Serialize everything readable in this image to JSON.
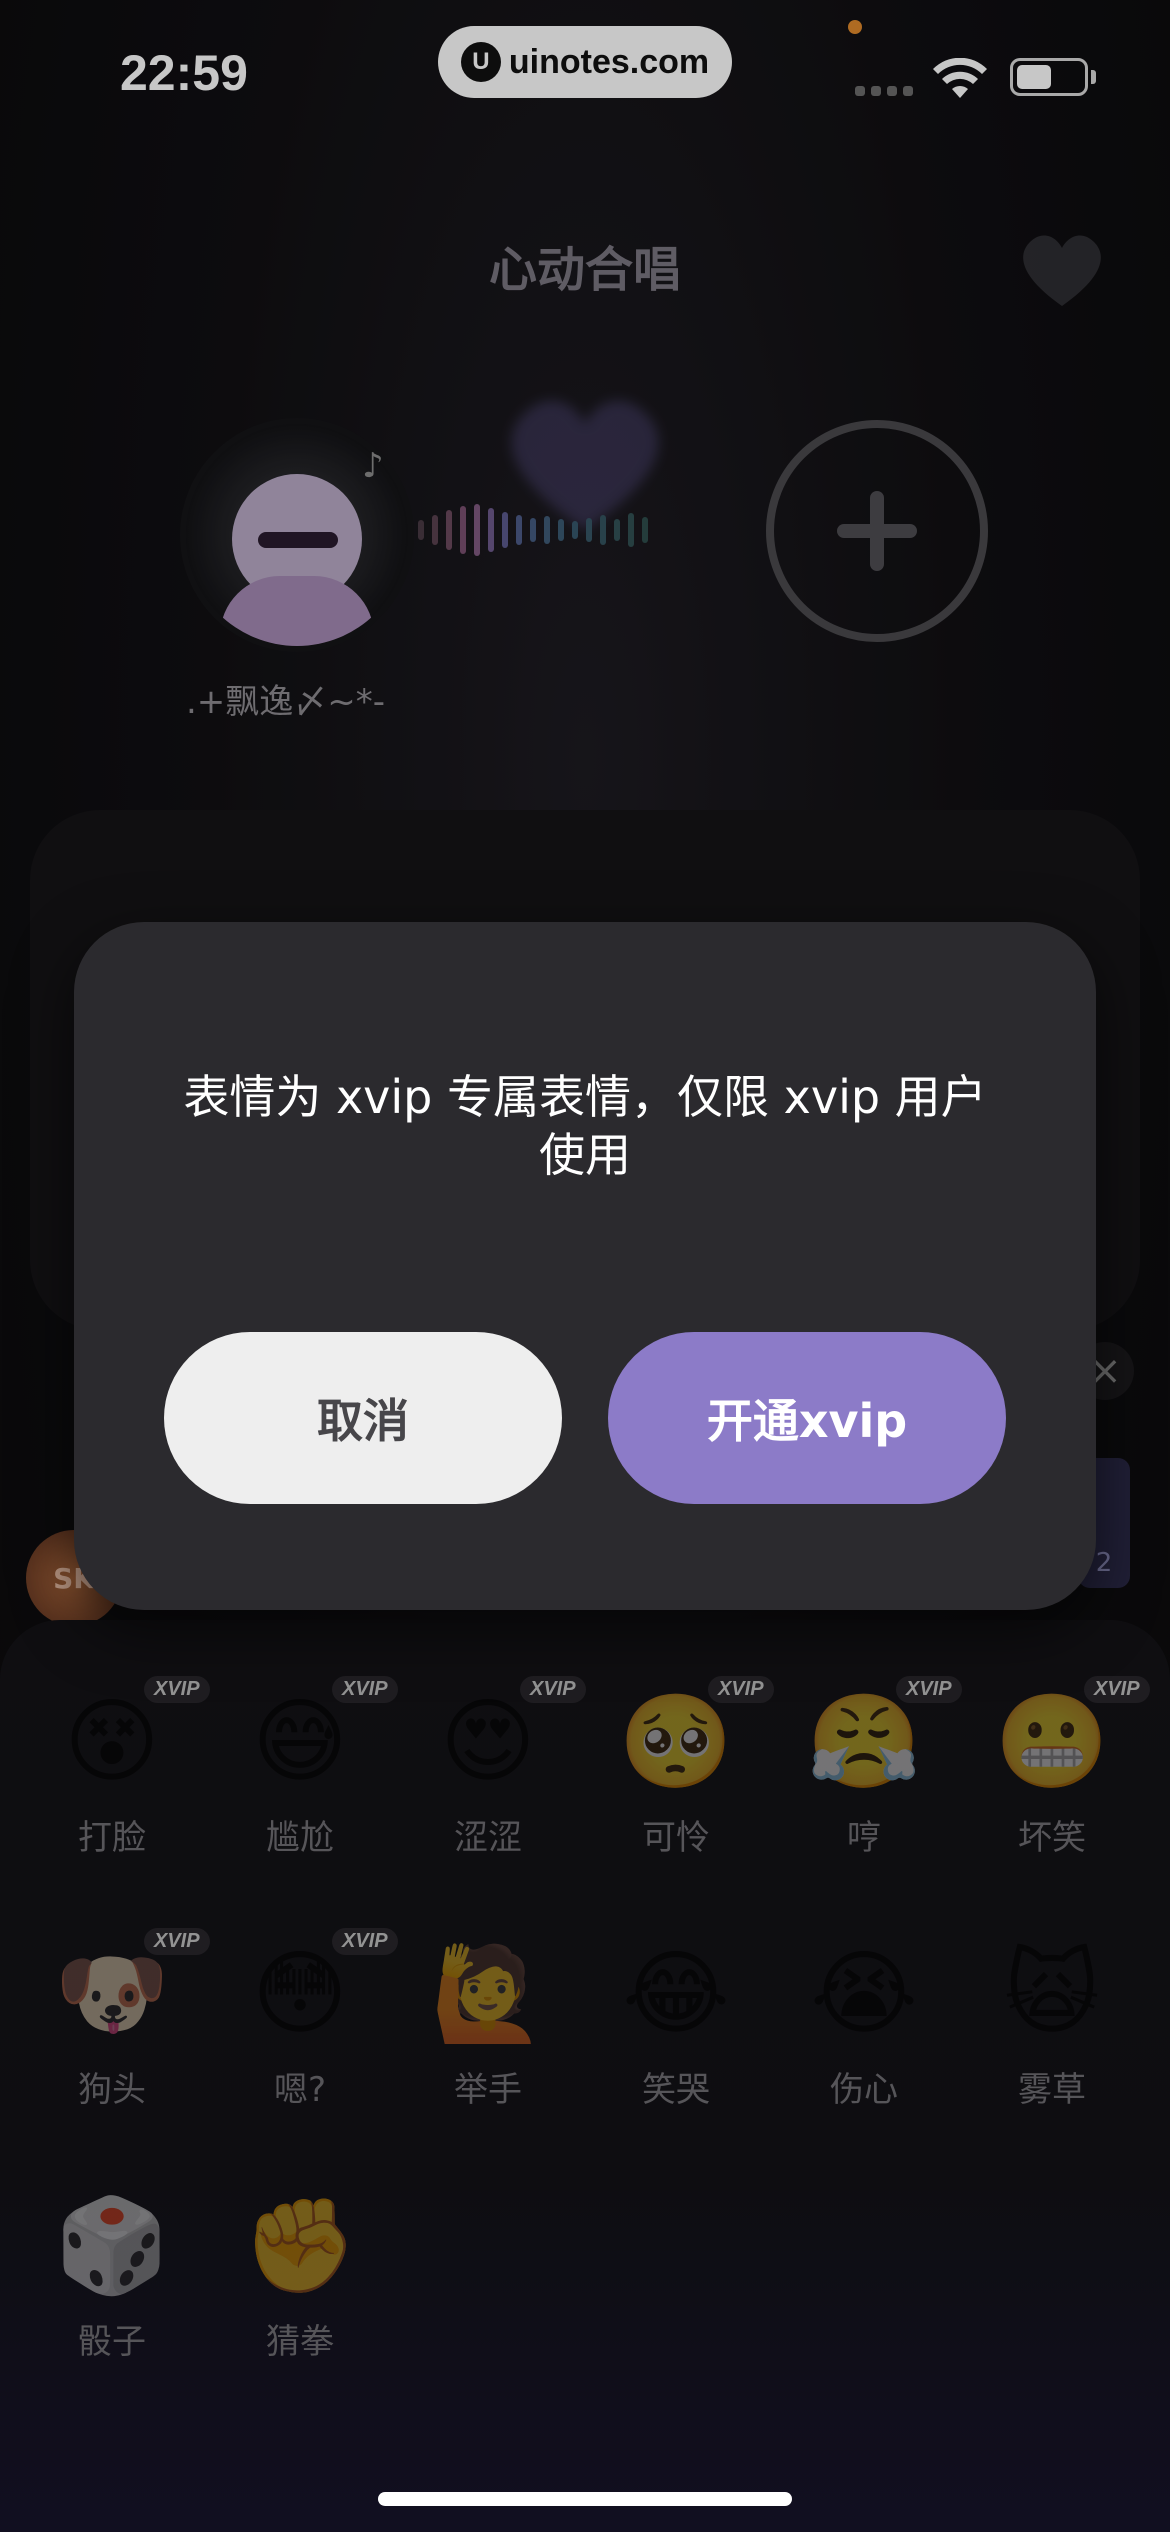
{
  "status_bar": {
    "time": "22:59",
    "url": "uinotes.com",
    "url_logo": "U",
    "icons": [
      "signal-icon",
      "wifi-icon",
      "battery-icon"
    ]
  },
  "room": {
    "title": "心动合唱",
    "username": ".+飘逸〆~*-",
    "music_note": "♪",
    "side_close": "×",
    "side_badge_number": "2",
    "left_badge": "SK"
  },
  "modal": {
    "message": "表情为 xvip 专属表情，仅限 xvip 用户使用",
    "cancel_label": "取消",
    "confirm_label": "开通xvip"
  },
  "emoji_panel": {
    "items": [
      {
        "label": "打脸",
        "glyph": "😵",
        "tag": "XVIP"
      },
      {
        "label": "尴尬",
        "glyph": "😅",
        "tag": "XVIP"
      },
      {
        "label": "涩涩",
        "glyph": "😍",
        "tag": "XVIP"
      },
      {
        "label": "可怜",
        "glyph": "🥺",
        "tag": "XVIP"
      },
      {
        "label": "哼",
        "glyph": "😤",
        "tag": "XVIP"
      },
      {
        "label": "坏笑",
        "glyph": "😬",
        "tag": "XVIP"
      },
      {
        "label": "狗头",
        "glyph": "🐶",
        "tag": "XVIP"
      },
      {
        "label": "嗯?",
        "glyph": "😳",
        "tag": "XVIP"
      },
      {
        "label": "举手",
        "glyph": "🙋",
        "tag": ""
      },
      {
        "label": "笑哭",
        "glyph": "😂",
        "tag": ""
      },
      {
        "label": "伤心",
        "glyph": "😭",
        "tag": ""
      },
      {
        "label": "雾草",
        "glyph": "🙀",
        "tag": ""
      },
      {
        "label": "骰子",
        "glyph": "🎲",
        "tag": ""
      },
      {
        "label": "猜拳",
        "glyph": "✊",
        "tag": ""
      }
    ]
  },
  "colors": {
    "accent": "#8c7bc8",
    "modal_bg": "#2b2a2e",
    "cancel_bg": "#eeeeee"
  }
}
